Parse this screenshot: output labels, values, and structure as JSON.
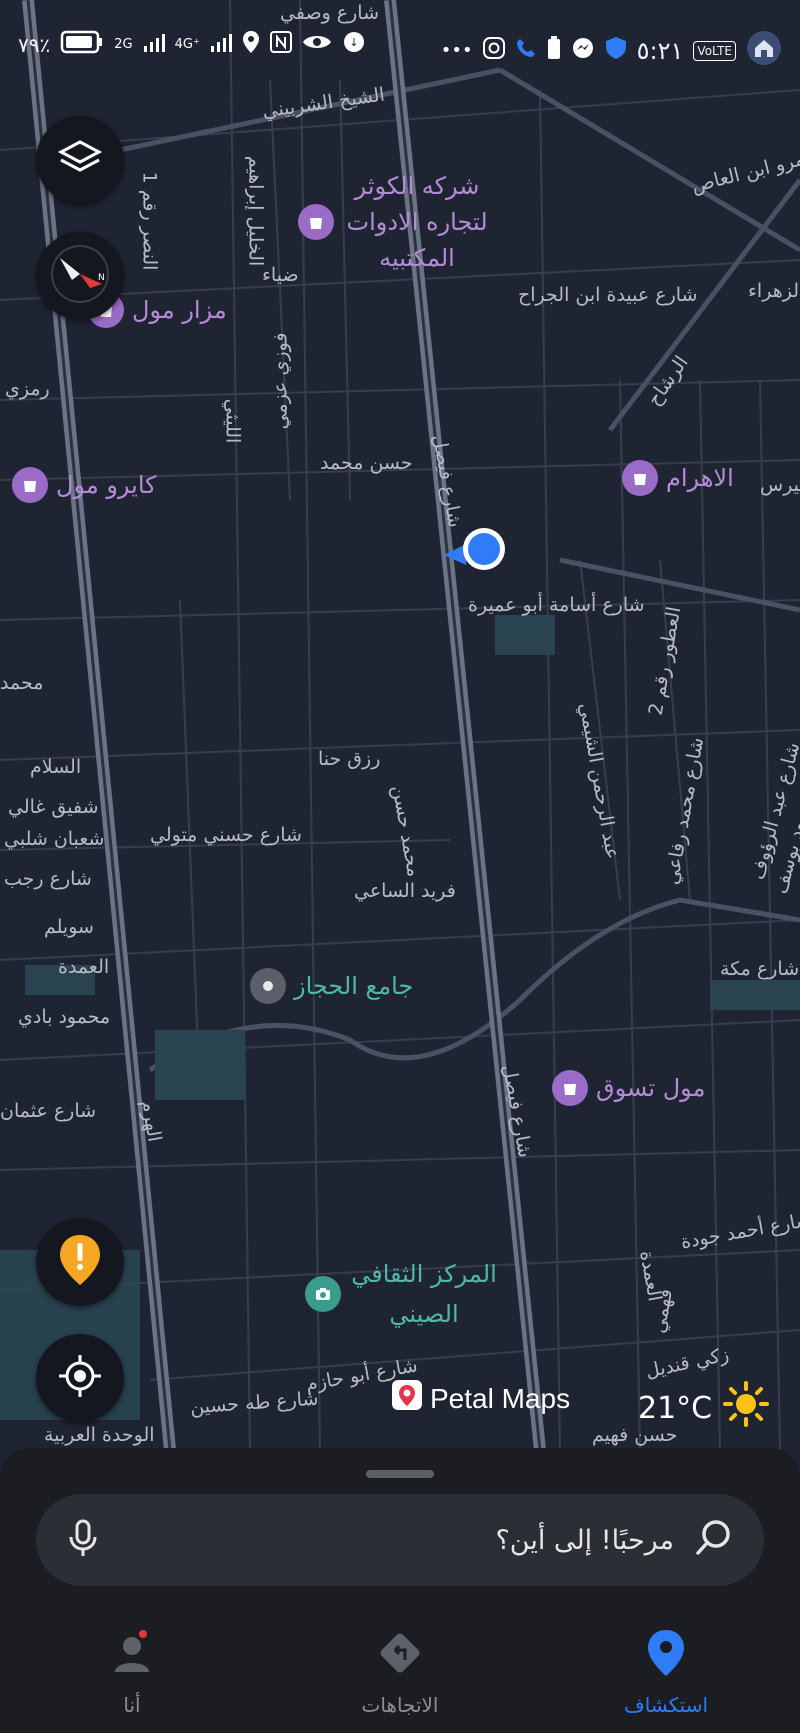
{
  "status_bar": {
    "battery_percent": "٧٩٪",
    "signal_1": "2G",
    "signal_2": "4G⁺",
    "time": "٥:٢١",
    "volte": "VoLTE"
  },
  "map": {
    "street_labels": [
      "شارع وصفي",
      "الشيخ الشربيني",
      "الخليل إبراهيم",
      "النصر رقم 1",
      "ضياء",
      "فوزي عزمي",
      "الليثي",
      "رمزي",
      "حسن محمد",
      "شارع فيصل",
      "شارع عبيدة ابن الجراح",
      "الزهراء",
      "عمرو ابن العاص",
      "الرشاح",
      "شارع أسامة أبو عميرة",
      "العطور رقم 2",
      "عبد الرحمن الشيمي",
      "شارع محمد رفاعي",
      "شارع عبد الرؤوف",
      "محمود يوسف",
      "رزق حنا",
      "محمد حسن",
      "شارع حسني متولي",
      "فريد الساعي",
      "السلام",
      "شفيق غالي",
      "شعبان شلبي",
      "شارع رجب",
      "سويلم",
      "العمدة",
      "محمود بادي",
      "شارع عثمان",
      "الهرم",
      "شارع فيصل",
      "شارع مكة",
      "شارع أحمد جودة",
      "العمدة",
      "فهمي",
      "زكي قنديل",
      "شارع أبو حازم",
      "شارع طه حسين",
      "الوحدة العربية",
      "حسن فهيم",
      "محمد",
      "بيرس"
    ],
    "pois": [
      {
        "name": "شركه الكوثر لتجاره الادوات المكتبيه",
        "icon": "shopping-bag-icon"
      },
      {
        "name": "مزار مول",
        "icon": "shopping-bag-icon"
      },
      {
        "name": "كايرو مول",
        "icon": "shopping-bag-icon"
      },
      {
        "name": "الاهرام",
        "icon": "shopping-bag-icon"
      },
      {
        "name": "جامع الحجاز",
        "icon": "place-dot-icon"
      },
      {
        "name": "مول تسوق",
        "icon": "shopping-bag-icon"
      },
      {
        "name": "المركز الثقافي الصيني",
        "icon": "camera-icon"
      }
    ],
    "brand": "Petal Maps",
    "temperature": "21°C"
  },
  "search": {
    "placeholder": "مرحبًا! إلى أين؟"
  },
  "tabs": [
    {
      "label": "استكشاف",
      "icon": "location-pin-icon",
      "active": true
    },
    {
      "label": "الاتجاهات",
      "icon": "directions-icon",
      "active": false
    },
    {
      "label": "أنا",
      "icon": "profile-icon",
      "active": false
    }
  ],
  "colors": {
    "accent": "#2f7cf6",
    "poi": "#9b6cc7",
    "warning": "#f5a623"
  }
}
